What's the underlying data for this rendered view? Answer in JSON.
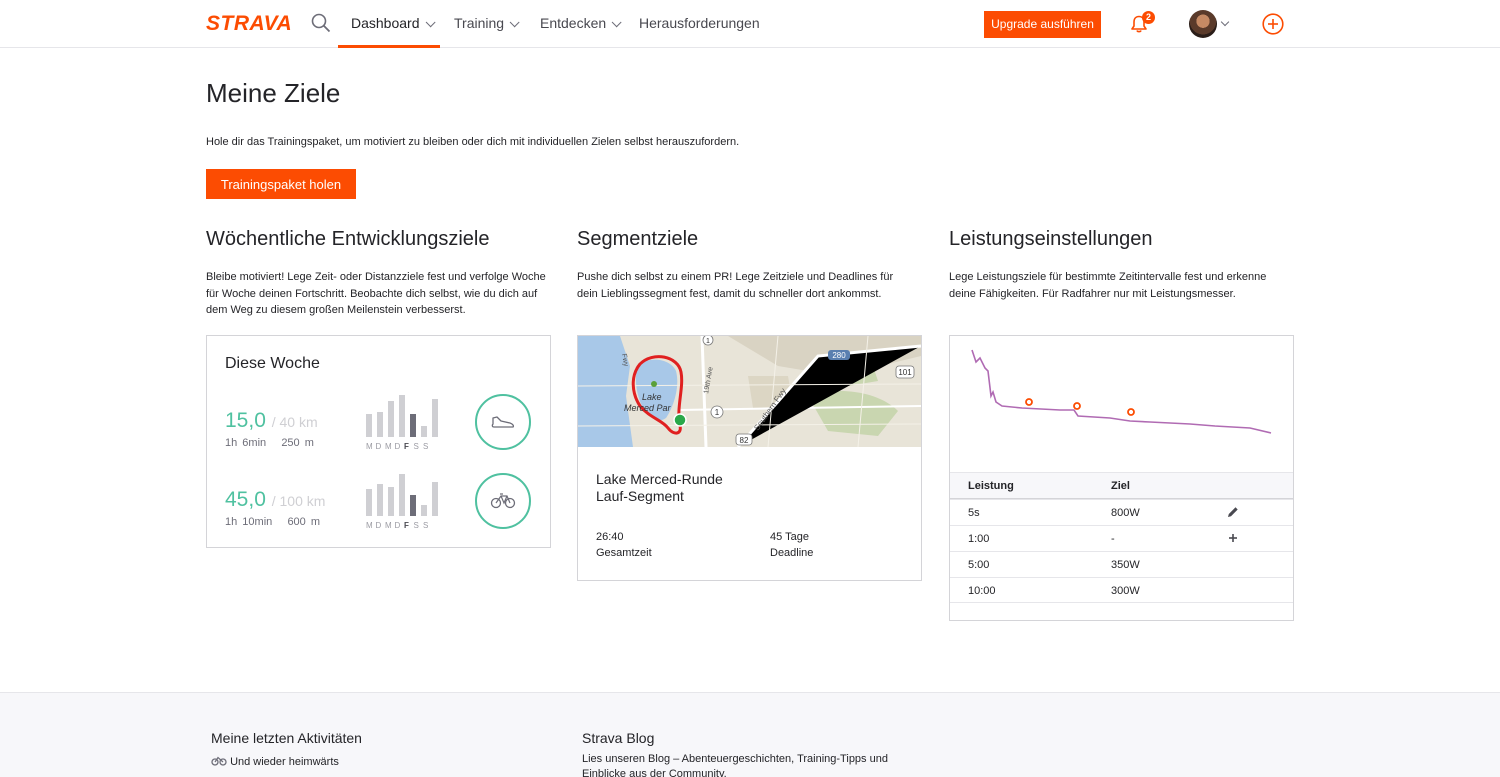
{
  "header": {
    "logo": "STRAVA",
    "nav": [
      {
        "label": "Dashboard"
      },
      {
        "label": "Training"
      },
      {
        "label": "Entdecken"
      },
      {
        "label": "Herausforderungen"
      }
    ],
    "upgrade_label": "Upgrade ausführen",
    "notification_count": "2",
    "accent_color": "#fc4c02"
  },
  "intro": {
    "title": "Meine Ziele",
    "text": "Hole dir das Trainingspaket, um motiviert zu bleiben oder dich mit individuellen Zielen selbst herauszufordern.",
    "cta_label": "Trainingspaket holen"
  },
  "weekly": {
    "title": "Wöchentliche Entwicklungsziele",
    "text": "Bleibe motiviert! Lege Zeit- oder Distanzziele fest und verfolge Woche für Woche deinen Fortschritt. Beobachte dich selbst, wie du dich auf dem Weg zu diesem großen Meilenstein verbesserst.",
    "card_title": "Diese Woche",
    "day_labels": [
      "M",
      "D",
      "M",
      "D",
      "F",
      "S",
      "S"
    ],
    "rows": [
      {
        "value": "15,0",
        "goal": "/ 40 km",
        "time": "1h 6min",
        "elevation": "250 m",
        "activity_icon": "run-shoe-icon",
        "progress_fraction": 0.375,
        "day_bars": [
          0.55,
          0.6,
          0.85,
          1.0,
          0.55,
          0.25,
          0.9
        ]
      },
      {
        "value": "45,0",
        "goal": "/ 100 km",
        "time": "1h 10min",
        "elevation": "600 m",
        "activity_icon": "bike-icon",
        "progress_fraction": 0.45,
        "day_bars": [
          0.65,
          0.75,
          0.7,
          1.0,
          0.5,
          0.25,
          0.8
        ]
      }
    ],
    "ring_color": "#4fc1a0"
  },
  "segment": {
    "title": "Segmentziele",
    "text": "Pushe dich selbst zu einem PR! Lege Zeitziele und Deadlines für dein Lieblingssegment fest, damit du schneller dort ankommst.",
    "map_labels": [
      "Lake",
      "Merced Par",
      "19th Ave",
      "Southern Fwy",
      "280",
      "101",
      "1",
      "1",
      "82",
      "Fwy"
    ],
    "segment_name_line1": "Lake Merced-Runde",
    "segment_name_line2": "Lauf-Segment",
    "total_time": "26:40",
    "total_time_label": "Gesamtzeit",
    "deadline": "45 Tage",
    "deadline_label": "Deadline"
  },
  "power": {
    "title": "Leistungseinstellungen",
    "text": "Lege Leistungsziele für bestimmte Zeitintervalle fest und erkenne deine Fähigkeiten. Für Radfahrer nur mit Leistungsmesser.",
    "col_power": "Leistung",
    "col_goal": "Ziel",
    "rows": [
      {
        "interval": "5s",
        "goal": "800W",
        "action_icon": "pencil-icon"
      },
      {
        "interval": "1:00",
        "goal": "-",
        "action_icon": "plus-icon"
      },
      {
        "interval": "5:00",
        "goal": "350W",
        "action_icon": ""
      },
      {
        "interval": "10:00",
        "goal": "300W",
        "action_icon": ""
      }
    ],
    "curve_color": "#b06bb3",
    "marker_color": "#fc4c02"
  },
  "footer": {
    "activities_title": "Meine letzten Aktivitäten",
    "activity_item": "Und wieder heimwärts",
    "blog_title": "Strava Blog",
    "blog_text_line1": "Lies unseren Blog – Abenteuergeschichten, Training-Tipps und",
    "blog_text_line2": "Einblicke aus der Community."
  }
}
